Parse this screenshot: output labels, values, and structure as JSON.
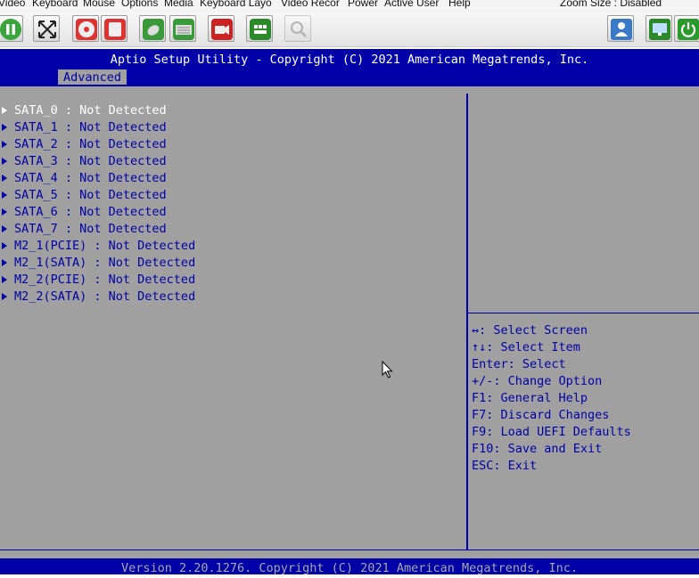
{
  "menubar": {
    "items": [
      "Video",
      "Keyboard",
      "Mouse",
      "Options",
      "Media",
      "Keyboard Layo",
      "Video Recor",
      "Power",
      "Active User",
      "Help"
    ],
    "zoom": "Zoom Size : Disabled"
  },
  "toolbar": {
    "buttons": [
      "pause",
      "fullscreen",
      "cd-media",
      "floppy-media",
      "mouse-sync",
      "virtual-keyboard",
      "video-record",
      "hotkeys",
      "zoom"
    ],
    "right_buttons": [
      "active-users",
      "display",
      "power"
    ]
  },
  "bios": {
    "title": "Aptio Setup Utility - Copyright (C) 2021 American Megatrends, Inc.",
    "active_tab": "Advanced",
    "items": [
      "SATA_0 : Not Detected",
      "SATA_1 : Not Detected",
      "SATA_2 : Not Detected",
      "SATA_3 : Not Detected",
      "SATA_4 : Not Detected",
      "SATA_5 : Not Detected",
      "SATA_6 : Not Detected",
      "SATA_7 : Not Detected",
      "M2_1(PCIE) : Not Detected",
      "M2_1(SATA) : Not Detected",
      "M2_2(PCIE) : Not Detected",
      "M2_2(SATA) : Not Detected"
    ],
    "help": [
      "↔: Select Screen",
      "↑↓: Select Item",
      "Enter: Select",
      "+/-: Change Option",
      "F1: General Help",
      "F7: Discard Changes",
      "F9: Load UEFI Defaults",
      "F10: Save and Exit",
      "ESC: Exit"
    ],
    "footer": "Version 2.20.1276. Copyright (C) 2021 American Megatrends, Inc.",
    "colors": {
      "blue": "#0000a8",
      "gray": "#a0a0a0",
      "selected": "#ffffff"
    }
  }
}
